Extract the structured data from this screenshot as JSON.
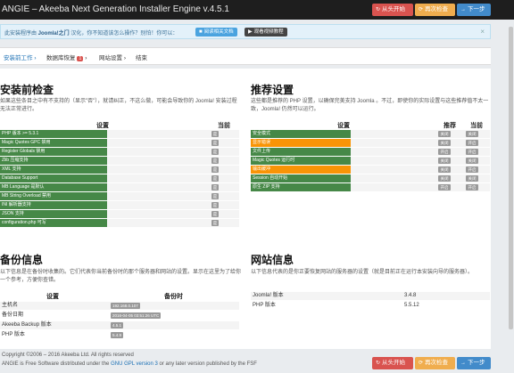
{
  "header": {
    "title": "ANGIE – Akeeba Next Generation Installer Engine v.4.5.1",
    "btn_restart": "从头开始",
    "btn_reload": "再次检查",
    "btn_next": "下一步"
  },
  "notice": {
    "text_prefix": "此安装程序由 ",
    "text_brand": "Joomla!之门",
    "text_suffix": " 汉化，你不知道该怎么操作？别怕！你可以：",
    "btn_docs": "阅读相关文档",
    "btn_video": "观看视频教程",
    "close": "×"
  },
  "steps": {
    "s1": "安装前工作",
    "s2": "数据库恢复",
    "s2_badge": "1",
    "s3": "网站设置",
    "s4": "结束"
  },
  "precheck": {
    "title": "安装前检查",
    "desc": "如果这些条目之中有不支持的（显示\"否\"），就请纠正，不这么做，可能会导致你的 Joomla! 安装过程无法正常进行。",
    "col_setting": "设置",
    "col_current": "当前",
    "items": [
      {
        "label": "PHP 版本 >= 5.3.1",
        "value": "是"
      },
      {
        "label": "Magic Quotes GPC 禁用",
        "value": "是"
      },
      {
        "label": "Register Globals 禁用",
        "value": "是"
      },
      {
        "label": "Zlib 压缩支持",
        "value": "是"
      },
      {
        "label": "XML 支持",
        "value": "是"
      },
      {
        "label": "Database Support",
        "value": "是"
      },
      {
        "label": "MB Language 是默认",
        "value": "是"
      },
      {
        "label": "MB String Overload 禁用",
        "value": "是"
      },
      {
        "label": "INI 解析器支持",
        "value": "是"
      },
      {
        "label": "JSON 支持",
        "value": "是"
      },
      {
        "label": "configuration.php 可写",
        "value": "是"
      }
    ]
  },
  "recommended": {
    "title": "推荐设置",
    "desc": "这些都是推荐的 PHP 设置，以确保完美支持 Joomla 。不过，即使你的实际设置与这些推荐值不太一致，Joomla! 仍然可以运行。",
    "col_setting": "设置",
    "col_recommended": "推荐",
    "col_current": "当前",
    "items": [
      {
        "label": "安全模式",
        "rec": "关闭",
        "cur": "关闭",
        "warn": false
      },
      {
        "label": "显示错误",
        "rec": "关闭",
        "cur": "开启",
        "warn": true
      },
      {
        "label": "文件上传",
        "rec": "开启",
        "cur": "开启",
        "warn": false
      },
      {
        "label": "Magic Quotes 运行时",
        "rec": "关闭",
        "cur": "关闭",
        "warn": false
      },
      {
        "label": "输出缓冲",
        "rec": "关闭",
        "cur": "开启",
        "warn": true
      },
      {
        "label": "Session 自动开始",
        "rec": "关闭",
        "cur": "关闭",
        "warn": false
      },
      {
        "label": "原生 ZIP 支持",
        "rec": "开启",
        "cur": "开启",
        "warn": false
      }
    ]
  },
  "backup": {
    "title": "备份信息",
    "desc": "以下信息是在备份时收集的。它们代表你当前备份时的那个服务器和网站的设置。显示在这里为了给你一个参考，方便你查错。",
    "col_setting": "设置",
    "col_backup": "备份时",
    "items": [
      {
        "label": "主机名",
        "value": "192.168.0.107"
      },
      {
        "label": "备份日期",
        "value": "2016-04-05 03:51:26 UTC"
      },
      {
        "label": "Akeeba Backup 版本",
        "value": "4.5.1"
      },
      {
        "label": "PHP 版本",
        "value": "5.4.9"
      }
    ]
  },
  "siteinfo": {
    "title": "网站信息",
    "desc": "以下信息代表的是你正要恢复网站的服务器的设置（就是目前正在运行本安装向导的服务器）。",
    "items": [
      {
        "label": "Joomla! 版本",
        "value": "3.4.8"
      },
      {
        "label": "PHP 版本",
        "value": "5.5.12"
      }
    ]
  },
  "footer": {
    "line1": "Copyright ©2006 – 2016 Akeeba Ltd. All rights reserved",
    "line2_a": "ANGIE is Free Software distributed under the ",
    "line2_link": "GNU GPL version 3",
    "line2_b": " or any later version published by the FSF"
  },
  "colors": {
    "green": "#468847",
    "orange": "#f89406",
    "red": "#d9534f",
    "blue": "#428bca",
    "amber": "#f0ad4e"
  }
}
